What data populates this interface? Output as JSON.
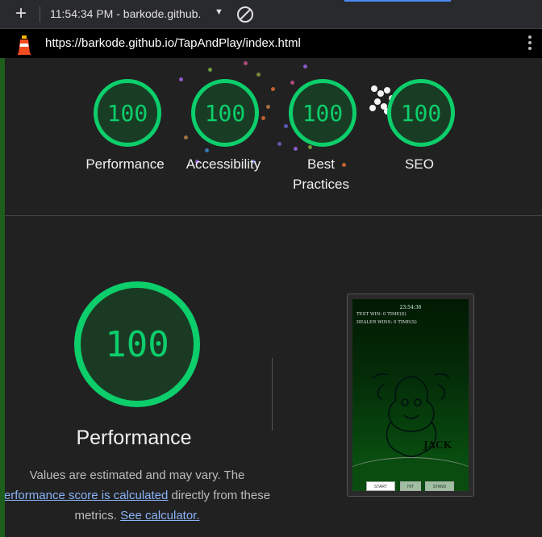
{
  "tab": {
    "time_title": "11:54:34 PM - barkode.github."
  },
  "address": {
    "url": "https://barkode.github.io/TapAndPlay/index.html"
  },
  "scores": [
    {
      "value": "100",
      "label": "Performance"
    },
    {
      "value": "100",
      "label": "Accessibility"
    },
    {
      "value": "100",
      "label": "Best Practices"
    },
    {
      "value": "100",
      "label": "SEO"
    }
  ],
  "performance": {
    "score": "100",
    "title": "Performance",
    "note_start": "Values are estimated and may vary. The ",
    "note_link": "erformance score is calculated",
    "note_mid": " directly from these metrics. ",
    "note_link2": "See calculator."
  },
  "game_screenshot": {
    "clock": "23:54:36",
    "player_wins": "TEST WIN: 0 TIME(S)",
    "dealer_wins": "DEALER WINS: 0 TIME(S)",
    "logo_text": "JACK",
    "buttons": [
      "START",
      "HIT",
      "STAND"
    ]
  },
  "colors": {
    "pass": "#0cce6b",
    "link": "#8ab4f8"
  },
  "icons": [
    "plus-icon",
    "caret-down-icon",
    "block-icon",
    "lighthouse-icon",
    "more-vert-icon"
  ]
}
